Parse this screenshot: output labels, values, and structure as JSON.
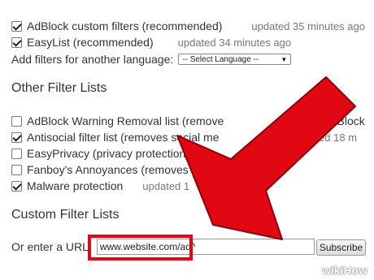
{
  "filters": [
    {
      "label": "AdBlock custom filters (recommended)",
      "meta": "updated 35 minutes ago",
      "checked": true
    },
    {
      "label": "EasyList (recommended)",
      "meta": "updated 34 minutes ago",
      "checked": true
    }
  ],
  "language": {
    "label": "Add filters for another language:",
    "selected": "-- Select Language --"
  },
  "other_title": "Other Filter Lists",
  "other_filters": [
    {
      "label": "AdBlock Warning Removal list (remove",
      "meta": "ut using AdBlock",
      "checked": false
    },
    {
      "label": "Antisocial filter list (removes social me",
      "meta": "updated 18 m",
      "checked": true
    },
    {
      "label": "EasyPrivacy (privacy protection)",
      "meta": "",
      "checked": false
    },
    {
      "label": "Fanboy's Annoyances (removes ann",
      "meta": "",
      "checked": false
    },
    {
      "label": "Malware protection",
      "meta": "updated 1",
      "checked": true
    }
  ],
  "custom_title": "Custom Filter Lists",
  "url_label": "Or enter a URL:",
  "url_value": "www.website.com/ad^",
  "subscribe_label": "Subscribe",
  "overlay_color": "#e10814",
  "watermark": "wikiHow"
}
